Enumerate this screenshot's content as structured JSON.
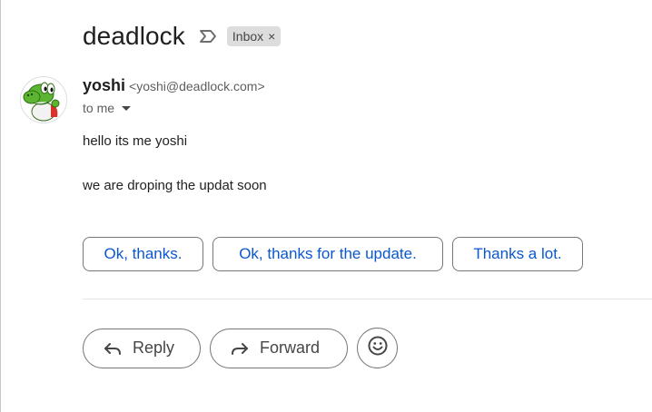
{
  "email": {
    "subject": "deadlock",
    "label": "Inbox",
    "label_close": "×",
    "sender": {
      "name": "yoshi",
      "email": "<yoshi@deadlock.com>"
    },
    "recipient": "to me",
    "body": [
      "hello its me yoshi",
      "we are droping the updat soon"
    ]
  },
  "smart_replies": [
    "Ok, thanks.",
    "Ok, thanks for the update.",
    "Thanks a lot."
  ],
  "actions": {
    "reply": "Reply",
    "forward": "Forward"
  },
  "icons": {
    "importance": "importance-marker-icon",
    "reply": "reply-arrow-icon",
    "forward": "forward-arrow-icon",
    "emoji": "smiley-icon",
    "recipient_details": "caret-down-icon"
  },
  "colors": {
    "link_blue": "#0b57d0",
    "chip_bg": "#dddddd",
    "avatar_green": "#5cb531"
  }
}
